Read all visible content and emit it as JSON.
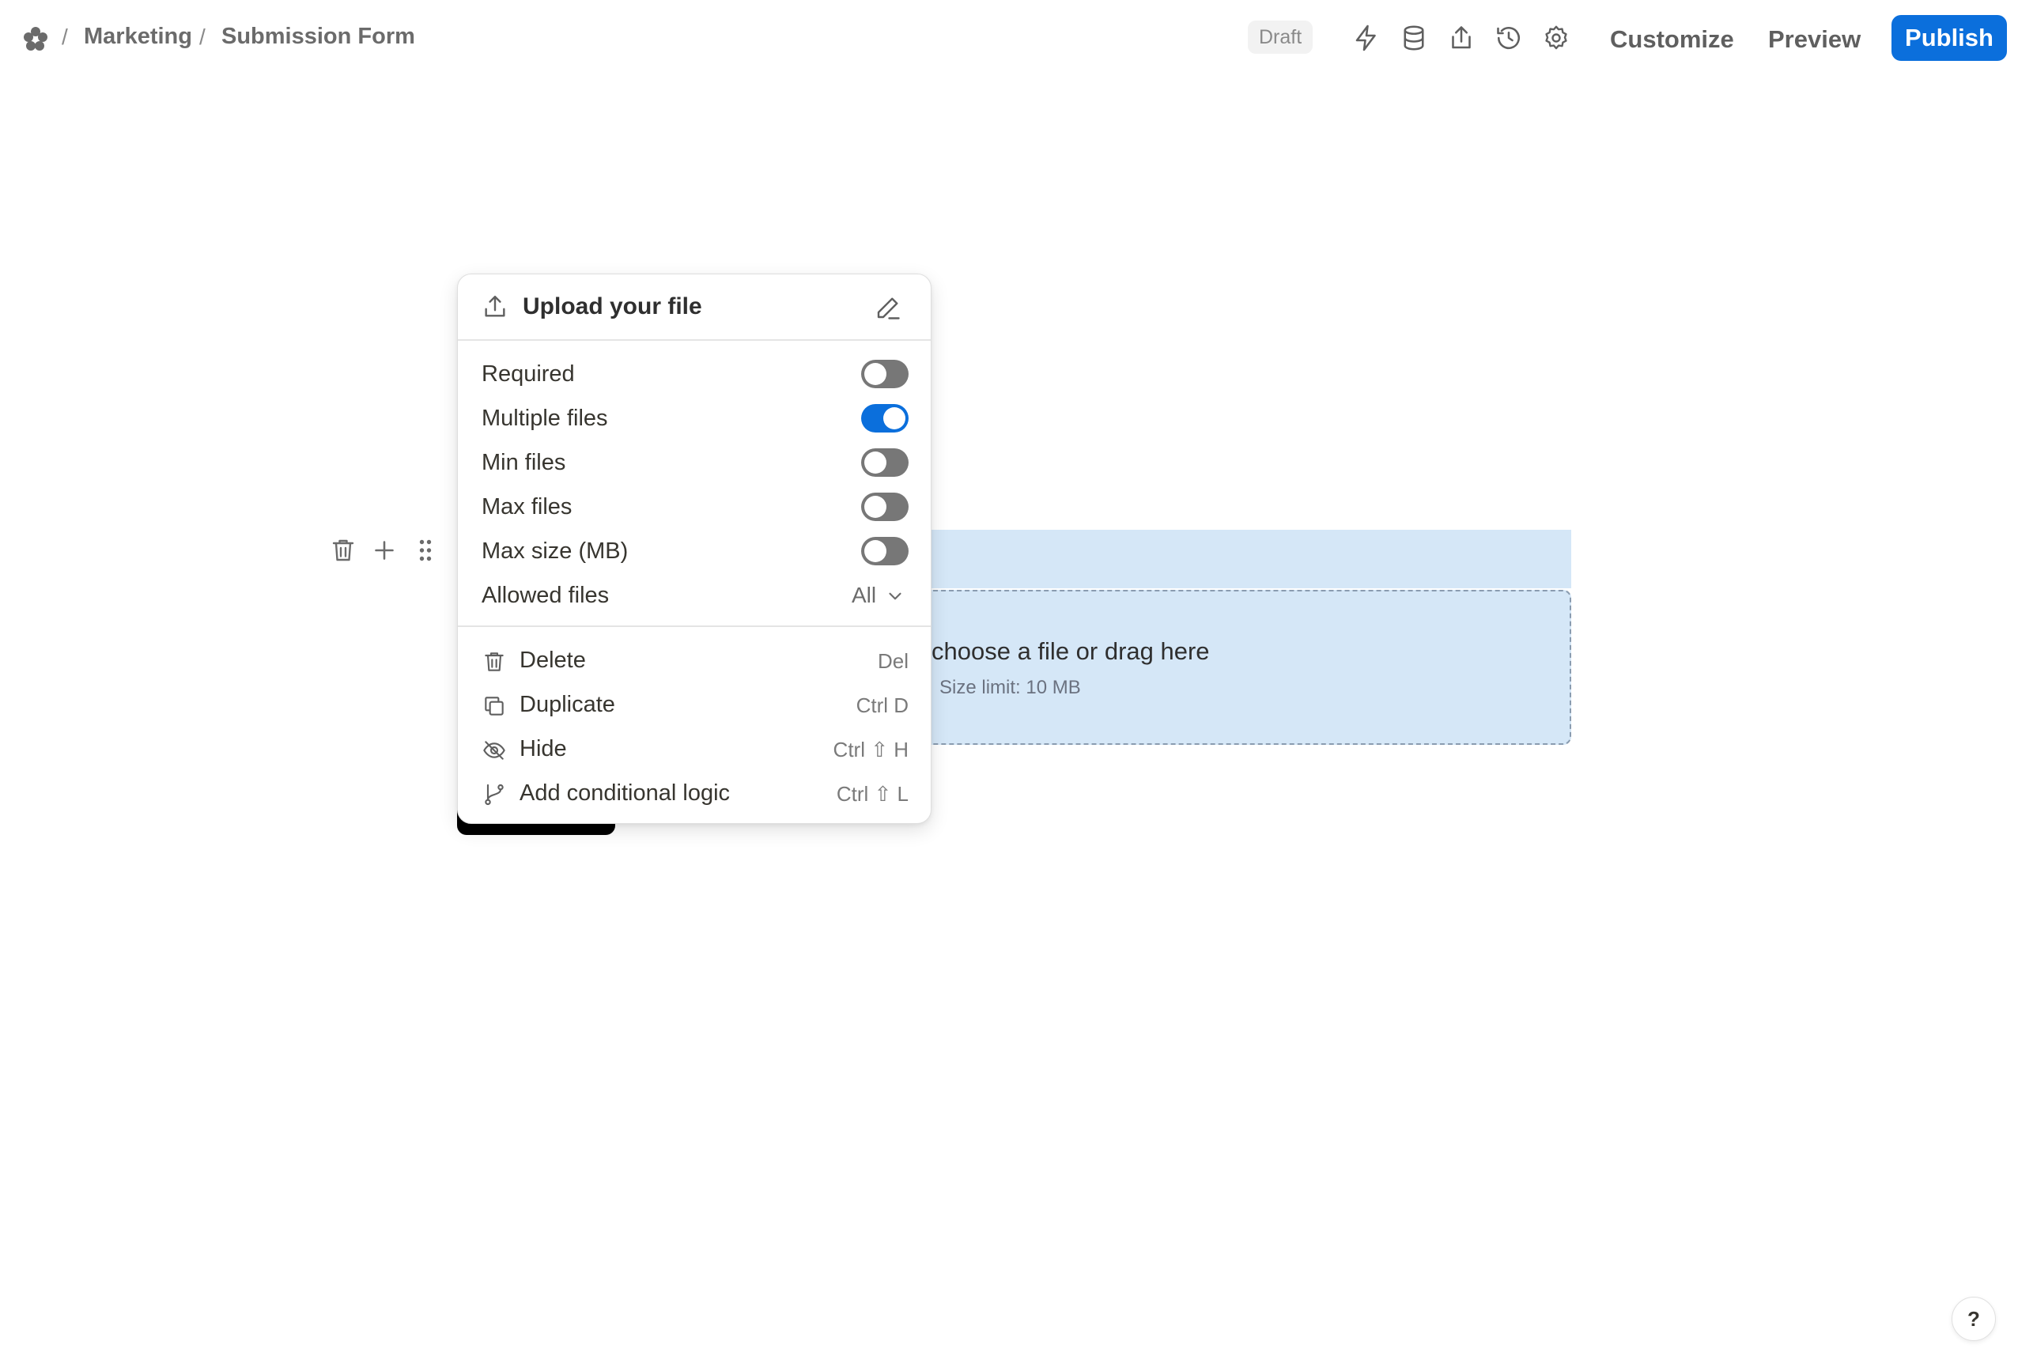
{
  "breadcrumb": {
    "workspace": "Marketing",
    "page": "Submission Form",
    "separator": "/"
  },
  "toolbar": {
    "status_badge": "Draft",
    "icons": [
      "lightning-icon",
      "database-icon",
      "share-icon",
      "history-icon",
      "gear-icon"
    ],
    "customize_label": "Customize",
    "preview_label": "Preview",
    "publish_label": "Publish",
    "accent_color": "#0b6fdc"
  },
  "form": {
    "title_visible": "m",
    "dropzone": {
      "main_text": "choose a file or drag here",
      "size_limit": "Size limit: 10 MB"
    },
    "field_bg_color": "#d5e7f7"
  },
  "menu": {
    "title": "Upload your file",
    "options": [
      {
        "label": "Required",
        "on": false
      },
      {
        "label": "Multiple files",
        "on": true
      },
      {
        "label": "Min files",
        "on": false
      },
      {
        "label": "Max files",
        "on": false
      },
      {
        "label": "Max size (MB)",
        "on": false
      }
    ],
    "allowed_files": {
      "label": "Allowed files",
      "value": "All"
    },
    "actions": [
      {
        "label": "Delete",
        "shortcut": "Del",
        "icon": "trash-icon"
      },
      {
        "label": "Duplicate",
        "shortcut": "Ctrl D",
        "icon": "duplicate-icon"
      },
      {
        "label": "Hide",
        "shortcut": "Ctrl ⇧ H",
        "icon": "eye-off-icon"
      },
      {
        "label": "Add conditional logic",
        "shortcut": "Ctrl ⇧ L",
        "icon": "branch-icon"
      }
    ]
  },
  "help": {
    "label": "?"
  }
}
